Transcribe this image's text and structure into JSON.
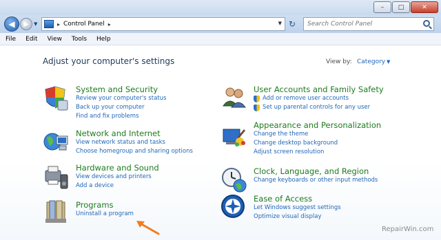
{
  "window": {
    "minimize": "–",
    "maximize": "□",
    "close": "✕"
  },
  "nav": {
    "address_path": "Control Panel",
    "address_separator": "▸",
    "search_placeholder": "Search Control Panel"
  },
  "menu": [
    "File",
    "Edit",
    "View",
    "Tools",
    "Help"
  ],
  "main": {
    "heading": "Adjust your computer's settings",
    "view_by_label": "View by:",
    "view_by_value": "Category"
  },
  "categories_left": [
    {
      "title": "System and Security",
      "icon": "system-security-icon",
      "links": [
        {
          "text": "Review your computer's status",
          "shield": false
        },
        {
          "text": "Back up your computer",
          "shield": false
        },
        {
          "text": "Find and fix problems",
          "shield": false
        }
      ]
    },
    {
      "title": "Network and Internet",
      "icon": "network-internet-icon",
      "links": [
        {
          "text": "View network status and tasks",
          "shield": false
        },
        {
          "text": "Choose homegroup and sharing options",
          "shield": false
        }
      ]
    },
    {
      "title": "Hardware and Sound",
      "icon": "hardware-sound-icon",
      "links": [
        {
          "text": "View devices and printers",
          "shield": false
        },
        {
          "text": "Add a device",
          "shield": false
        }
      ]
    },
    {
      "title": "Programs",
      "icon": "programs-icon",
      "links": [
        {
          "text": "Uninstall a program",
          "shield": false
        }
      ]
    }
  ],
  "categories_right": [
    {
      "title": "User Accounts and Family Safety",
      "icon": "user-accounts-icon",
      "links": [
        {
          "text": "Add or remove user accounts",
          "shield": true
        },
        {
          "text": "Set up parental controls for any user",
          "shield": true
        }
      ]
    },
    {
      "title": "Appearance and Personalization",
      "icon": "appearance-icon",
      "links": [
        {
          "text": "Change the theme",
          "shield": false
        },
        {
          "text": "Change desktop background",
          "shield": false
        },
        {
          "text": "Adjust screen resolution",
          "shield": false
        }
      ]
    },
    {
      "title": "Clock, Language, and Region",
      "icon": "clock-language-icon",
      "links": [
        {
          "text": "Change keyboards or other input methods",
          "shield": false
        }
      ]
    },
    {
      "title": "Ease of Access",
      "icon": "ease-of-access-icon",
      "links": [
        {
          "text": "Let Windows suggest settings",
          "shield": false
        },
        {
          "text": "Optimize visual display",
          "shield": false
        }
      ]
    }
  ],
  "watermark": "RepairWin.com",
  "annotation": {
    "arrow_color": "#f47a1f"
  }
}
